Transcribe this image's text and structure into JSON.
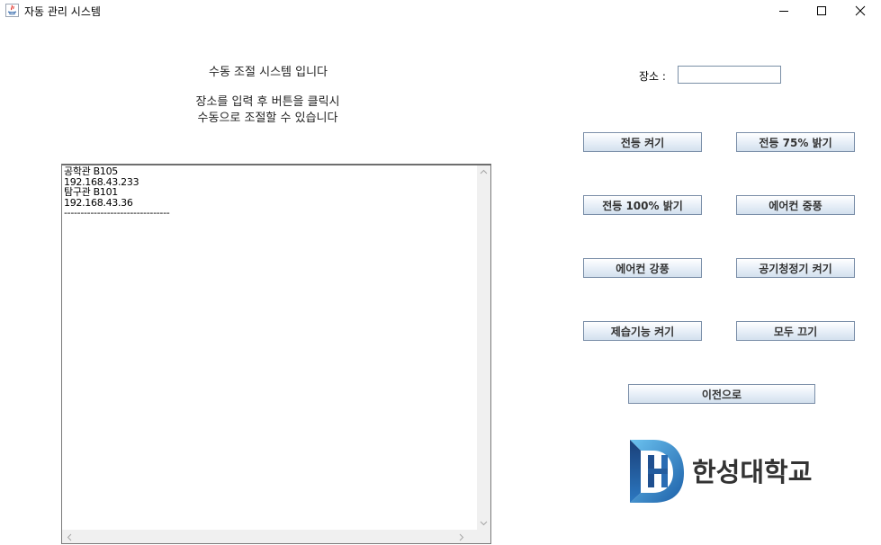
{
  "window": {
    "title": "자동 관리 시스템",
    "controls": {
      "minimize": "—",
      "maximize": "☐",
      "close": "✕"
    }
  },
  "header": {
    "line1": "수동 조절 시스템 입니다",
    "line2": "장소를 입력 후 버튼을 클릭시",
    "line3": "수동으로 조절할 수 있습니다"
  },
  "log": {
    "lines": [
      "공학관 B105",
      "192.168.43.233",
      "탐구관 B101",
      "192.168.43.36",
      "--------------------------------"
    ]
  },
  "location": {
    "label": "장소 :",
    "value": "",
    "placeholder": ""
  },
  "buttons": {
    "light_on": "전등 켜기",
    "light_75": "전등 75% 밝기",
    "light_100": "전등 100% 밝기",
    "ac_medium": "에어컨 중풍",
    "ac_strong": "에어컨 강풍",
    "purifier_on": "공기청정기 켜기",
    "dehumidify_on": "제습기능 켜기",
    "all_off": "모두 끄기",
    "back": "이전으로"
  },
  "logo": {
    "text": "한성대학교",
    "colors": {
      "dark": "#1b4f8f",
      "light": "#4aa3de"
    }
  }
}
